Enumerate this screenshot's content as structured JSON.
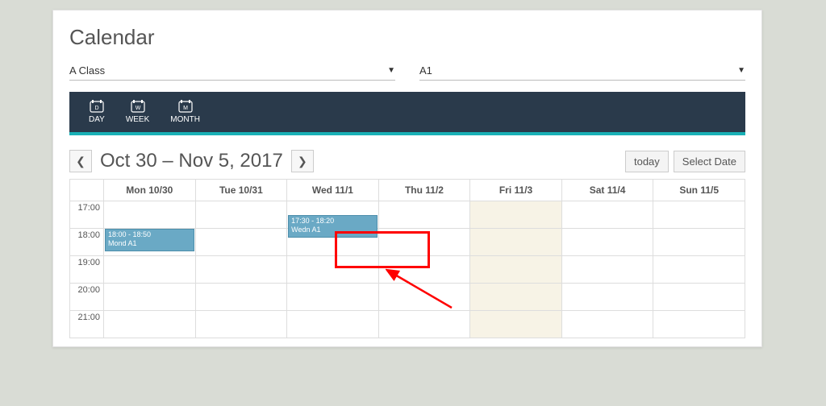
{
  "title": "Calendar",
  "selects": {
    "class": "A Class",
    "group": "A1"
  },
  "views": {
    "day": "DAY",
    "week": "WEEK",
    "month": "MONTH"
  },
  "range": "Oct 30 – Nov 5, 2017",
  "buttons": {
    "today": "today",
    "select_date": "Select Date"
  },
  "days": [
    "Mon 10/30",
    "Tue 10/31",
    "Wed 11/1",
    "Thu 11/2",
    "Fri 11/3",
    "Sat 11/4",
    "Sun 11/5"
  ],
  "hours": [
    "17:00",
    "18:00",
    "19:00",
    "20:00",
    "21:00"
  ],
  "events": {
    "mon": {
      "time": "18:00 - 18:50",
      "name": "Mond A1"
    },
    "wed": {
      "time": "17:30 - 18:20",
      "name": "Wedn A1"
    }
  }
}
